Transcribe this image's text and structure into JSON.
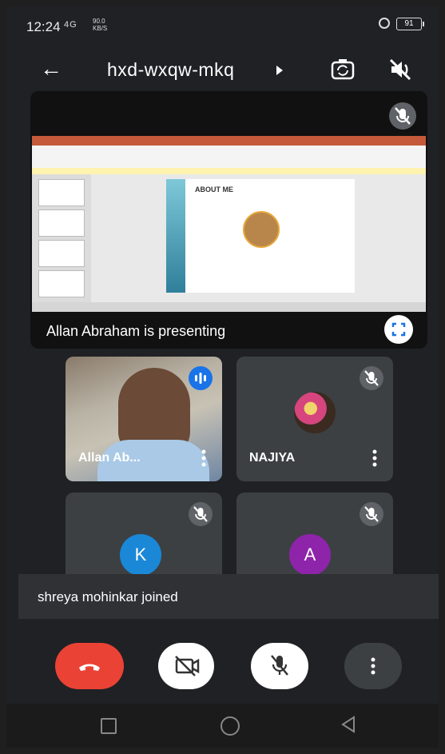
{
  "status_bar": {
    "time": "12:24",
    "network": "4G",
    "data_rate": "90.0",
    "data_rate_unit": "KB/S",
    "battery": "91"
  },
  "header": {
    "meeting_code": "hxd-wxqw-mkq"
  },
  "presentation": {
    "slide_heading": "ABOUT ME",
    "presenter_label": "Allan Abraham is presenting"
  },
  "participants": [
    {
      "name": "Allan Ab...",
      "muted": false,
      "speaking": true
    },
    {
      "name": "NAJIYA",
      "muted": true
    },
    {
      "initial": "K",
      "muted": true,
      "color": "#1a88d6"
    },
    {
      "initial": "A",
      "muted": true,
      "color": "#8e24aa"
    }
  ],
  "toast": {
    "message": "shreya mohinkar joined"
  },
  "colors": {
    "hangup": "#ea4335",
    "accent": "#1a73e8"
  },
  "icons": {
    "back": "arrow-left-icon",
    "switch_camera": "switch-camera-icon",
    "audio_off": "speaker-off-icon",
    "hangup": "phone-hangup-icon",
    "camera_off": "camera-off-icon",
    "mic_off": "mic-off-icon",
    "more": "more-vertical-icon"
  }
}
